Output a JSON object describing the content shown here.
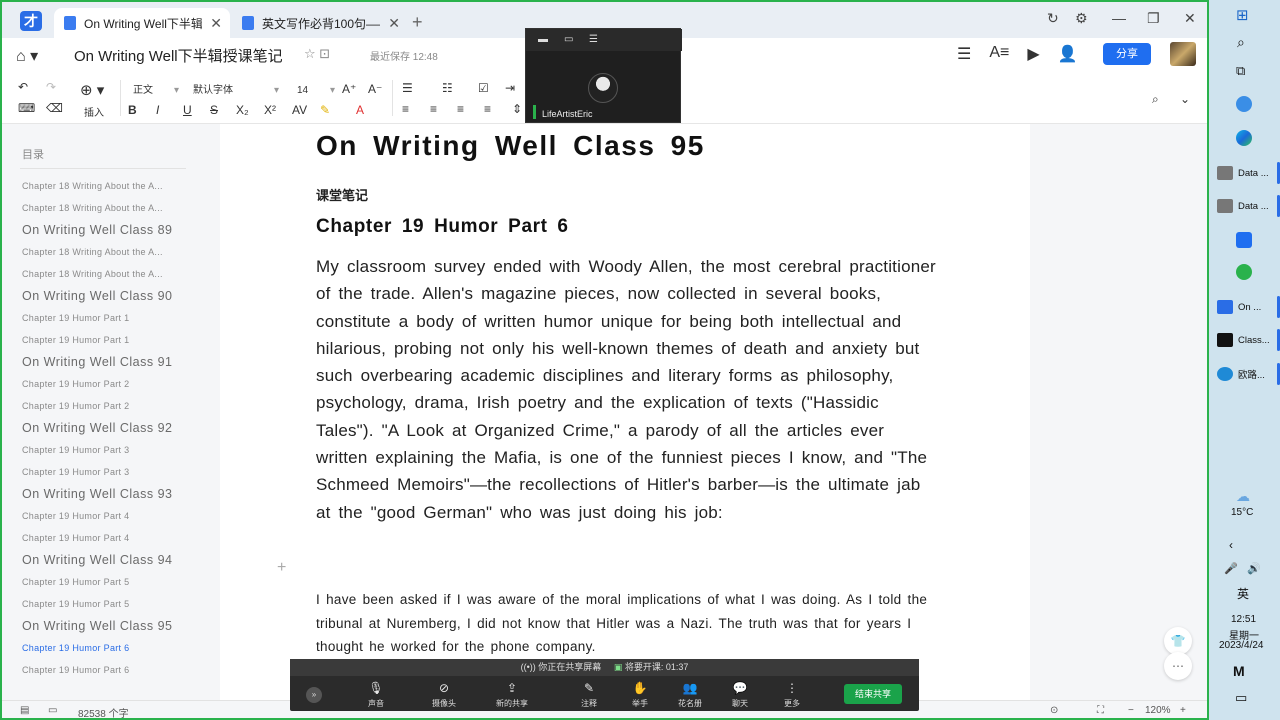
{
  "tabs": [
    {
      "title": "On Writing Well下半辑...",
      "active": true
    },
    {
      "title": "英文写作必背100句——...",
      "active": false
    }
  ],
  "window": {
    "title": "On Writing Well下半辑授课笔记",
    "save_status": "最近保存 12:48",
    "share_label": "分享"
  },
  "toolbar": {
    "insert_label": "插入",
    "style_value": "正文",
    "font_value": "默认字体",
    "size_value": "14",
    "bold": "B",
    "italic": "I",
    "underline": "U",
    "strike": "S",
    "subscript": "X₂",
    "superscript": "X²",
    "font_color": "A"
  },
  "sidebar": {
    "heading": "目录",
    "items": [
      {
        "label": "Chapter 18 Writing About the A...",
        "level": 3,
        "active": false
      },
      {
        "label": "Chapter 18 Writing About the A...",
        "level": 3,
        "active": false
      },
      {
        "label": "On Writing Well Class 89",
        "level": 2,
        "active": false
      },
      {
        "label": "Chapter 18 Writing About the A...",
        "level": 3,
        "active": false
      },
      {
        "label": "Chapter 18 Writing About the A...",
        "level": 3,
        "active": false
      },
      {
        "label": "On Writing Well Class 90",
        "level": 2,
        "active": false
      },
      {
        "label": "Chapter 19 Humor Part 1",
        "level": 3,
        "active": false
      },
      {
        "label": "Chapter 19 Humor Part 1",
        "level": 3,
        "active": false
      },
      {
        "label": "On Writing Well Class 91",
        "level": 2,
        "active": false
      },
      {
        "label": "Chapter 19 Humor Part 2",
        "level": 3,
        "active": false
      },
      {
        "label": "Chapter 19 Humor Part 2",
        "level": 3,
        "active": false
      },
      {
        "label": "On Writing Well Class 92",
        "level": 2,
        "active": false
      },
      {
        "label": "Chapter 19 Humor Part 3",
        "level": 3,
        "active": false
      },
      {
        "label": "Chapter 19 Humor Part 3",
        "level": 3,
        "active": false
      },
      {
        "label": "On Writing Well Class 93",
        "level": 2,
        "active": false
      },
      {
        "label": "Chapter 19 Humor Part 4",
        "level": 3,
        "active": false
      },
      {
        "label": "Chapter 19 Humor Part 4",
        "level": 3,
        "active": false
      },
      {
        "label": "On Writing Well Class 94",
        "level": 2,
        "active": false
      },
      {
        "label": "Chapter 19 Humor Part 5",
        "level": 3,
        "active": false
      },
      {
        "label": "Chapter 19 Humor Part 5",
        "level": 3,
        "active": false
      },
      {
        "label": "On Writing Well Class 95",
        "level": 2,
        "active": false
      },
      {
        "label": "Chapter 19 Humor Part 6",
        "level": 3,
        "active": true
      },
      {
        "label": "Chapter 19 Humor Part 6",
        "level": 3,
        "active": false
      }
    ]
  },
  "document": {
    "title": "On Writing Well Class 95",
    "note_label": "课堂笔记",
    "chapter_heading": "Chapter 19 Humor Part 6",
    "paragraph": "My classroom survey ended with Woody Allen, the most cerebral practitioner of the trade. Allen's magazine pieces, now collected in several books, constitute a body of written humor unique for being both intellectual and hilarious, probing not only his well-known themes of death and anxiety but such overbearing academic disciplines and literary forms as philosophy, psychology, drama, Irish poetry and the explication of texts (\"Hassidic Tales\"). \"A Look at Organized Crime,\" a parody of all the articles ever written explaining the Mafia, is one of the funniest pieces I know, and \"The Schmeed Memoirs\"—the recollections of Hitler's barber—is the ultimate jab at the \"good German\" who was just doing his job:",
    "quote": "I have been asked if I was aware of the moral implications of what I was doing. As I told the tribunal at Nuremberg, I did not know that Hitler was a Nazi. The truth was that for years I thought he worked for the phone company."
  },
  "statusbar": {
    "word_count": "82538 个字",
    "zoom": "120%"
  },
  "video": {
    "name": "LifeArtistEric"
  },
  "sharebar": {
    "status": "你正在共享屏幕",
    "class_timer": "将要开课: 01:37",
    "buttons": [
      "声音",
      "摄像头",
      "新的共享",
      "注释",
      "举手",
      "花名册",
      "聊天",
      "更多"
    ],
    "end_label": "结束共享"
  },
  "taskbar": {
    "apps": [
      "Data ...",
      "Data ...",
      "On ...",
      "Class...",
      "欧路..."
    ],
    "weather": "15°C",
    "ime": "英",
    "time": "12:51",
    "weekday": "星期一",
    "date": "2023/4/24"
  },
  "colors": {
    "accent": "#1f6ef0",
    "frame": "#2ab24c",
    "active_toc": "#2a6de6"
  }
}
